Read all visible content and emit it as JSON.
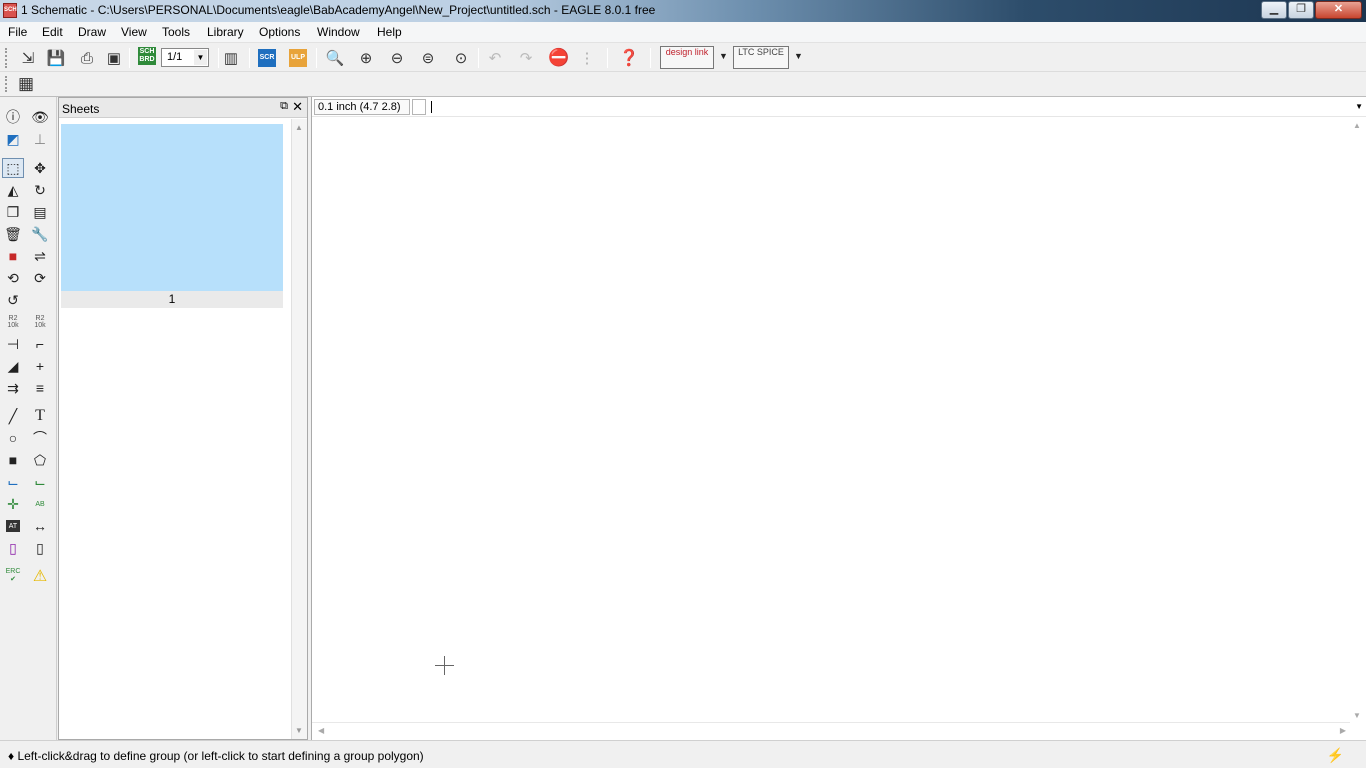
{
  "window": {
    "title": "1 Schematic - C:\\Users\\PERSONAL\\Documents\\eagle\\BabAcademyAngel\\New_Project\\untitled.sch - EAGLE 8.0.1 free",
    "app_icon_label": "SCH"
  },
  "menu": [
    "File",
    "Edit",
    "Draw",
    "View",
    "Tools",
    "Library",
    "Options",
    "Window",
    "Help"
  ],
  "toolbar": {
    "sheet_selector": "1/1",
    "sch_brd_label": "SCH BRD",
    "scr_label": "SCR",
    "ulp_label": "ULP",
    "design_link_label": "design link",
    "ltspice_label": "LTC SPICE"
  },
  "sheets_panel": {
    "title": "Sheets",
    "sheet_number": "1",
    "thumb_color": "#b7e0fb"
  },
  "command_bar": {
    "coordinates": "0.1 inch (4.7 2.8)",
    "command_value": ""
  },
  "left_tools": {
    "r2_label_top": "R2",
    "r2_label_bottom": "10k",
    "erc_label": "ERC",
    "name_label": "AB",
    "value_label": "AT"
  },
  "status": {
    "message": "♦ Left-click&drag to define group (or left-click to start defining a group polygon)"
  }
}
